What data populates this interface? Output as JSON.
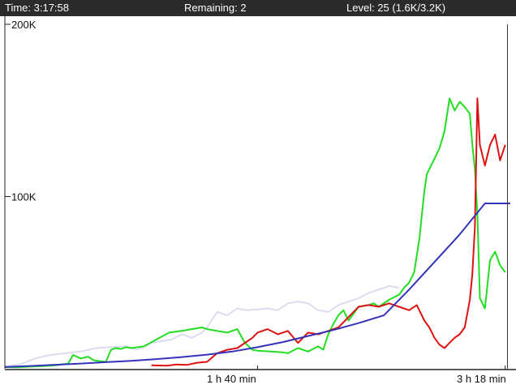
{
  "status_bar": {
    "time": "Time: 3:17:58",
    "remaining": "Remaining: 2",
    "level": "Level: 25 (1.6K/3.2K)"
  },
  "chart_data": {
    "type": "line",
    "ylim": [
      0,
      200000
    ],
    "y_ticks": [
      {
        "value": 200000,
        "label": "200K"
      },
      {
        "value": 100000,
        "label": "100K"
      }
    ],
    "x_unit": "minutes",
    "xlim": [
      0,
      201
    ],
    "x_ticks": [
      {
        "value": 100,
        "label": "1 h 40 min"
      },
      {
        "value": 198,
        "label": "3 h 18 min"
      }
    ],
    "colors": {
      "lavender": "#dcdcf0",
      "green": "#22dd22",
      "red": "#dd1111",
      "blue": "#3333bb",
      "axis": "#222222",
      "cursor": "#333333"
    },
    "cursor_x": 198.9,
    "series": [
      {
        "color_key": "lavender",
        "x": [
          0,
          6,
          12,
          18,
          24,
          30,
          36,
          42,
          48,
          52,
          54,
          58,
          62,
          66,
          70,
          74,
          78,
          80,
          84,
          88,
          92,
          96,
          100,
          104,
          108,
          112,
          116,
          120,
          124,
          128,
          132,
          136,
          140,
          144,
          148,
          152,
          156
        ],
        "y": [
          1500,
          2500,
          6000,
          8000,
          9000,
          10000,
          12000,
          12500,
          13000,
          11000,
          12000,
          15000,
          16000,
          17000,
          20000,
          18000,
          21000,
          24000,
          33000,
          31000,
          35000,
          34000,
          34500,
          35000,
          34000,
          38000,
          39000,
          38000,
          34000,
          33000,
          37000,
          39000,
          41000,
          44000,
          46000,
          48000,
          47000
        ]
      },
      {
        "color_key": "green",
        "x": [
          0,
          5,
          10,
          15,
          20,
          25,
          27,
          30,
          33,
          35,
          37,
          40,
          42,
          44,
          46,
          48,
          50,
          55,
          60,
          65,
          70,
          74,
          78,
          80,
          84,
          88,
          92,
          95,
          98,
          100,
          110,
          112,
          116,
          120,
          124,
          126,
          128,
          130,
          132,
          134,
          136,
          140,
          144,
          146,
          148,
          152,
          156,
          158,
          160,
          162,
          164,
          166,
          167,
          168,
          170,
          172,
          174,
          176,
          178,
          180,
          182,
          184,
          185,
          186,
          187,
          188,
          190,
          192,
          194,
          196,
          198
        ],
        "y": [
          1000,
          800,
          1200,
          1500,
          2000,
          3000,
          8000,
          6000,
          7000,
          5000,
          4500,
          4000,
          11000,
          12000,
          11500,
          12500,
          12000,
          13000,
          17000,
          21000,
          22000,
          23000,
          24000,
          23000,
          22000,
          21000,
          23000,
          15000,
          11000,
          10500,
          9500,
          9000,
          12000,
          10000,
          13000,
          11000,
          20000,
          26000,
          31000,
          34000,
          28000,
          36000,
          37000,
          38000,
          36000,
          40000,
          43000,
          47000,
          50000,
          56000,
          75000,
          103000,
          113000,
          116000,
          122000,
          128000,
          138000,
          157000,
          150000,
          155000,
          152000,
          148000,
          130000,
          116000,
          90000,
          41000,
          35000,
          63000,
          68000,
          60000,
          56000
        ]
      },
      {
        "color_key": "red",
        "x": [
          58,
          64,
          68,
          72,
          76,
          80,
          84,
          88,
          92,
          96,
          98,
          100,
          104,
          108,
          112,
          116,
          120,
          124,
          128,
          132,
          136,
          140,
          144,
          148,
          152,
          156,
          160,
          163,
          166,
          168,
          170,
          172,
          174,
          176,
          178,
          180,
          182,
          184,
          185,
          186,
          187,
          188,
          190,
          192,
          194,
          196,
          198
        ],
        "y": [
          2000,
          1800,
          2500,
          2200,
          3500,
          4000,
          9000,
          11000,
          12000,
          16000,
          18000,
          21000,
          23000,
          20000,
          22000,
          15000,
          21000,
          20000,
          22000,
          24000,
          30000,
          36000,
          37000,
          36000,
          38000,
          36000,
          34000,
          37000,
          28000,
          24000,
          18000,
          14000,
          12000,
          15000,
          18000,
          20000,
          24000,
          40000,
          55000,
          82000,
          157000,
          130000,
          118000,
          130000,
          136000,
          121000,
          130000
        ]
      },
      {
        "color_key": "blue",
        "x": [
          0,
          10,
          20,
          30,
          40,
          50,
          60,
          70,
          80,
          90,
          100,
          110,
          120,
          130,
          140,
          150,
          160,
          170,
          180,
          190,
          200
        ],
        "y": [
          1000,
          1600,
          2300,
          3000,
          3800,
          4600,
          5600,
          6800,
          8200,
          10000,
          12500,
          15500,
          19000,
          22500,
          26500,
          31000,
          46000,
          62000,
          78000,
          96000,
          96000
        ]
      }
    ]
  }
}
